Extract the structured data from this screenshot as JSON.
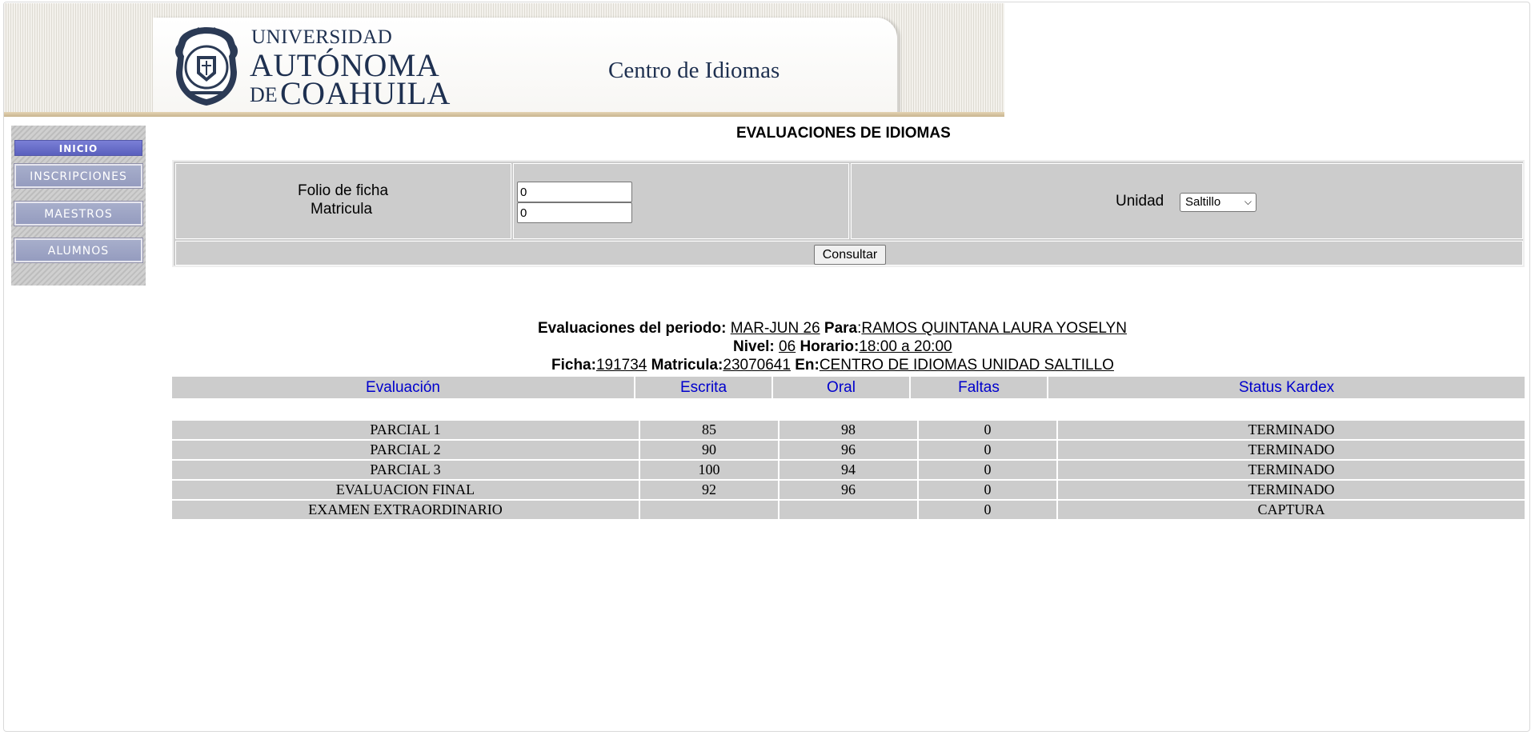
{
  "header": {
    "university_line1": "UNIVERSIDAD",
    "university_line2": "AUTÓNOMA",
    "university_line3_prefix": "DE",
    "university_line3": "COAHUILA",
    "center_name": "Centro de Idiomas",
    "seal_icon": "university-seal-icon"
  },
  "sidebar": {
    "items": [
      {
        "label": "INICIO"
      },
      {
        "label": "INSCRIPCIONES"
      },
      {
        "label": "MAESTROS"
      },
      {
        "label": "ALUMNOS"
      }
    ]
  },
  "page_title": "EVALUACIONES DE IDIOMAS",
  "search": {
    "folio_label": "Folio de ficha",
    "matricula_label": "Matricula",
    "folio_value": "0",
    "matricula_value": "0",
    "unidad_label": "Unidad",
    "unidad_selected": "Saltillo",
    "submit_label": "Consultar"
  },
  "info": {
    "periodo_label": "Evaluaciones del periodo:",
    "periodo_value": "MAR-JUN 26",
    "para_label": "Para",
    "para_value": "RAMOS QUINTANA LAURA YOSELYN",
    "nivel_label": "Nivel:",
    "nivel_value": "06",
    "horario_label": "Horario:",
    "horario_value": "18:00 a 20:00",
    "ficha_label": "Ficha:",
    "ficha_value": "191734",
    "matricula_label": "Matricula:",
    "matricula_value": "23070641",
    "en_label": "En:",
    "en_value": "CENTRO DE IDIOMAS UNIDAD SALTILLO"
  },
  "results": {
    "columns": [
      "Evaluación",
      "Escrita",
      "Oral",
      "Faltas",
      "Status Kardex"
    ],
    "rows": [
      [
        "PARCIAL 1",
        "85",
        "98",
        "0",
        "TERMINADO"
      ],
      [
        "PARCIAL 2",
        "90",
        "96",
        "0",
        "TERMINADO"
      ],
      [
        "PARCIAL 3",
        "100",
        "94",
        "0",
        "TERMINADO"
      ],
      [
        "EVALUACION FINAL",
        "92",
        "96",
        "0",
        "TERMINADO"
      ],
      [
        "EXAMEN EXTRAORDINARIO",
        "",
        "",
        "0",
        "CAPTURA"
      ]
    ]
  },
  "colors": {
    "header_text": "#0000cc",
    "table_bg": "#cccccc",
    "inicio_button": "#6a6fcb",
    "nav_button": "#9ea5c6"
  }
}
